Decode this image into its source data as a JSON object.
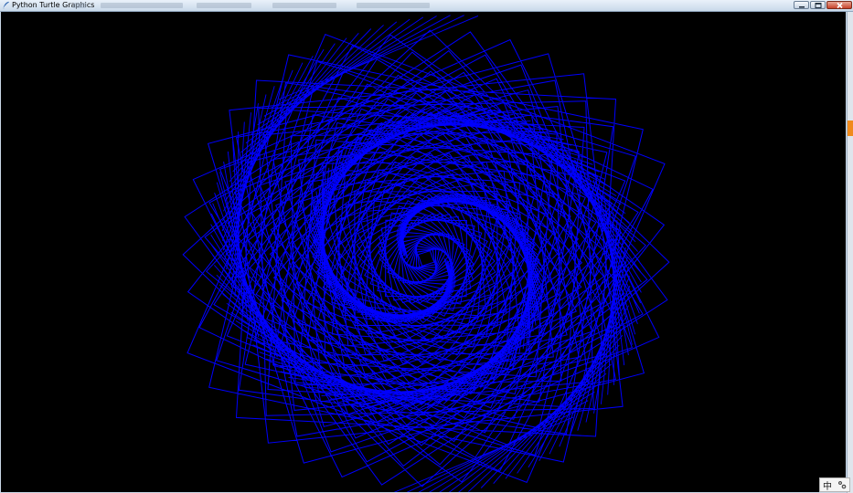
{
  "window": {
    "title": "Python Turtle Graphics",
    "app_icon": "feather-pen-icon",
    "controls": [
      "minimize-icon",
      "maximize-icon",
      "close-icon"
    ]
  },
  "canvas": {
    "background": "#000000",
    "stroke_color": "#0000ff",
    "drawing": "rotating-squares-spiral"
  },
  "ime": {
    "mode_label": "中",
    "settings_icon": "ime-settings-icon"
  },
  "colors": {
    "titlebar": "#c9d9ea",
    "close_button": "#c8432b",
    "side_accent": "#f08a1c"
  }
}
